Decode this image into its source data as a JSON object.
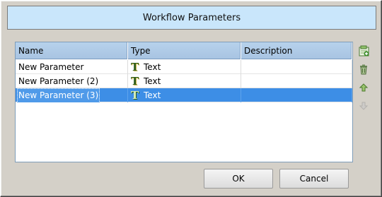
{
  "dialog": {
    "title": "Workflow Parameters"
  },
  "table": {
    "columns": [
      "Name",
      "Type",
      "Description"
    ],
    "rows": [
      {
        "name": "New Parameter",
        "type": "Text",
        "type_icon": "text-type-icon",
        "description": "",
        "selected": false
      },
      {
        "name": "New Parameter (2)",
        "type": "Text",
        "type_icon": "text-type-icon",
        "description": "",
        "selected": false
      },
      {
        "name": "New Parameter (3)",
        "type": "Text",
        "type_icon": "text-type-icon",
        "description": "",
        "selected": true
      }
    ]
  },
  "tools": [
    {
      "name": "add-parameter-icon",
      "enabled": true
    },
    {
      "name": "delete-icon",
      "enabled": true
    },
    {
      "name": "move-up-icon",
      "enabled": true
    },
    {
      "name": "move-down-icon",
      "enabled": false
    }
  ],
  "buttons": {
    "ok_label": "OK",
    "cancel_label": "Cancel"
  },
  "colors": {
    "title_bg": "#c9e6fb",
    "header_bg": "#b7d2ec",
    "selection": "#3d8ee6"
  }
}
